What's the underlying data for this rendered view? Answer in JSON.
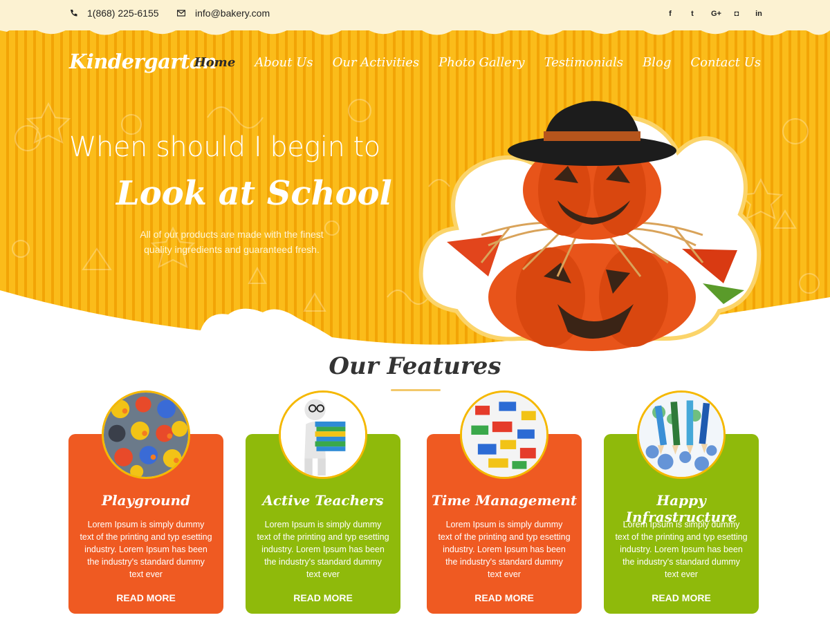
{
  "topbar": {
    "phone": "1(868) 225-6155",
    "email": "info@bakery.com",
    "socials": [
      {
        "icon": "facebook-icon",
        "glyph": "f"
      },
      {
        "icon": "twitter-icon",
        "glyph": "t"
      },
      {
        "icon": "google-plus-icon",
        "glyph": "G+"
      },
      {
        "icon": "instagram-icon",
        "glyph": "◘"
      },
      {
        "icon": "linkedin-icon",
        "glyph": "in"
      }
    ]
  },
  "header": {
    "logo": "Kindergartan",
    "nav": [
      "Home",
      "About Us",
      "Our Activities",
      "Photo Gallery",
      "Testimonials",
      "Blog",
      "Contact Us"
    ],
    "active_nav": "Home"
  },
  "hero": {
    "line1": "When should I begin to",
    "line2": "Look at School",
    "subtitle": "All of our products are made with the finest quality ingredients and guaranteed fresh."
  },
  "features": {
    "title": "Our Features",
    "cards": [
      {
        "title": "Playground",
        "text": "Lorem Ipsum is simply dummy text of the printing and typ esetting industry. Lorem Ipsum has been the industry's standard dummy text ever",
        "button": "READ MORE",
        "color": "#ef5a22",
        "image": "rubber-ducks-image"
      },
      {
        "title": "Active Teachers",
        "text": "Lorem Ipsum is simply dummy text of the printing and typ esetting industry. Lorem Ipsum has been the industry's standard dummy text ever",
        "button": "READ MORE",
        "color": "#8fba0b",
        "image": "teacher-with-books-image"
      },
      {
        "title": "Time Management",
        "text": "Lorem Ipsum is simply dummy text of the printing and typ esetting industry. Lorem Ipsum has been the industry's standard dummy text ever",
        "button": "READ MORE",
        "color": "#ef5a22",
        "image": "lego-blocks-image"
      },
      {
        "title": "Happy Infrastructure",
        "text": "Lorem Ipsum is simply dummy text of the printing and typ esetting industry. Lorem Ipsum has been the industry's standard dummy text ever",
        "button": "READ MORE",
        "color": "#8fba0b",
        "image": "colored-pencils-image"
      }
    ]
  },
  "colors": {
    "hero_yellow": "#f7ae0c",
    "topbar_cream": "#fcf2d2",
    "card_orange": "#ef5a22",
    "card_green": "#8fba0b",
    "circle_border": "#f5b800"
  }
}
